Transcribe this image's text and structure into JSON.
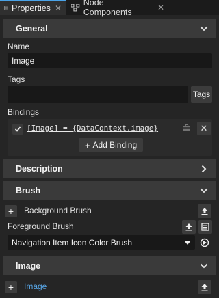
{
  "tabs": [
    {
      "label": "Properties"
    },
    {
      "label": "Node Components"
    }
  ],
  "sections": {
    "general": "General",
    "description": "Description",
    "brush": "Brush",
    "image": "Image"
  },
  "fields": {
    "name_label": "Name",
    "name_value": "Image",
    "tags_label": "Tags",
    "tags_value": "",
    "tags_button": "Tags",
    "bindings_label": "Bindings",
    "binding_expression": "[Image] = {DataContext.image}",
    "add_binding_button": "Add Binding"
  },
  "brush": {
    "background_label": "Background Brush",
    "foreground_label": "Foreground Brush",
    "foreground_value": "Navigation Item Icon Color Brush"
  },
  "image_section": {
    "image_label": "Image"
  },
  "colors": {
    "accent": "#4aa3e8",
    "link": "#58a6e6",
    "panel": "#252525",
    "section": "#3a3a3a",
    "field": "#181818"
  }
}
